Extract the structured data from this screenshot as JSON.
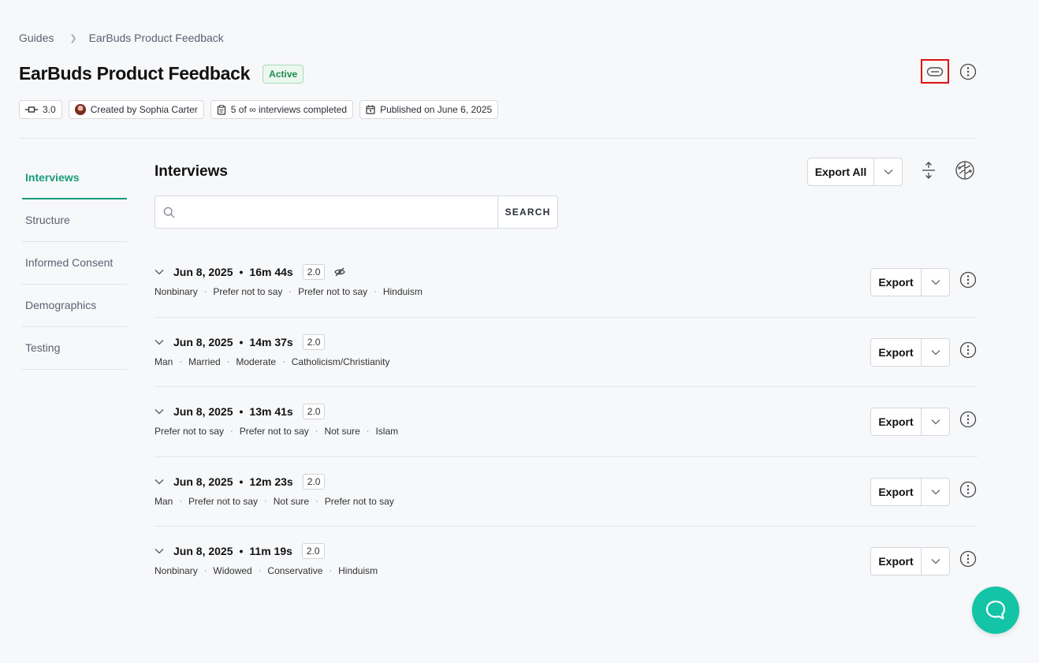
{
  "breadcrumb": {
    "root": "Guides",
    "current": "EarBuds Product Feedback"
  },
  "header": {
    "title": "EarBuds Product Feedback",
    "status": "Active"
  },
  "meta": {
    "version": "3.0",
    "created_by": "Created by Sophia Carter",
    "interviews": "5 of ∞ interviews completed",
    "published": "Published on June 6, 2025"
  },
  "nav": {
    "items": [
      {
        "label": "Interviews",
        "active": true
      },
      {
        "label": "Structure"
      },
      {
        "label": "Informed Consent"
      },
      {
        "label": "Demographics"
      },
      {
        "label": "Testing"
      }
    ]
  },
  "main": {
    "title": "Interviews",
    "export_all_label": "Export All",
    "search": {
      "placeholder": "",
      "button_label": "SEARCH"
    }
  },
  "interviews": [
    {
      "date": "Jun 8, 2025",
      "duration": "16m 44s",
      "version": "2.0",
      "hidden": true,
      "tags": [
        "Nonbinary",
        "Prefer not to say",
        "Prefer not to say",
        "Hinduism"
      ],
      "export_label": "Export"
    },
    {
      "date": "Jun 8, 2025",
      "duration": "14m 37s",
      "version": "2.0",
      "tags": [
        "Man",
        "Married",
        "Moderate",
        "Catholicism/Christianity"
      ],
      "export_label": "Export"
    },
    {
      "date": "Jun 8, 2025",
      "duration": "13m 41s",
      "version": "2.0",
      "tags": [
        "Prefer not to say",
        "Prefer not to say",
        "Not sure",
        "Islam"
      ],
      "export_label": "Export"
    },
    {
      "date": "Jun 8, 2025",
      "duration": "12m 23s",
      "version": "2.0",
      "tags": [
        "Man",
        "Prefer not to say",
        "Not sure",
        "Prefer not to say"
      ],
      "export_label": "Export"
    },
    {
      "date": "Jun 8, 2025",
      "duration": "11m 19s",
      "version": "2.0",
      "tags": [
        "Nonbinary",
        "Widowed",
        "Conservative",
        "Hinduism"
      ],
      "export_label": "Export"
    }
  ],
  "colors": {
    "accent": "#1a9b7a",
    "fab": "#14c4a6",
    "status": "#1e8a4c",
    "highlight": "#dd1111"
  }
}
